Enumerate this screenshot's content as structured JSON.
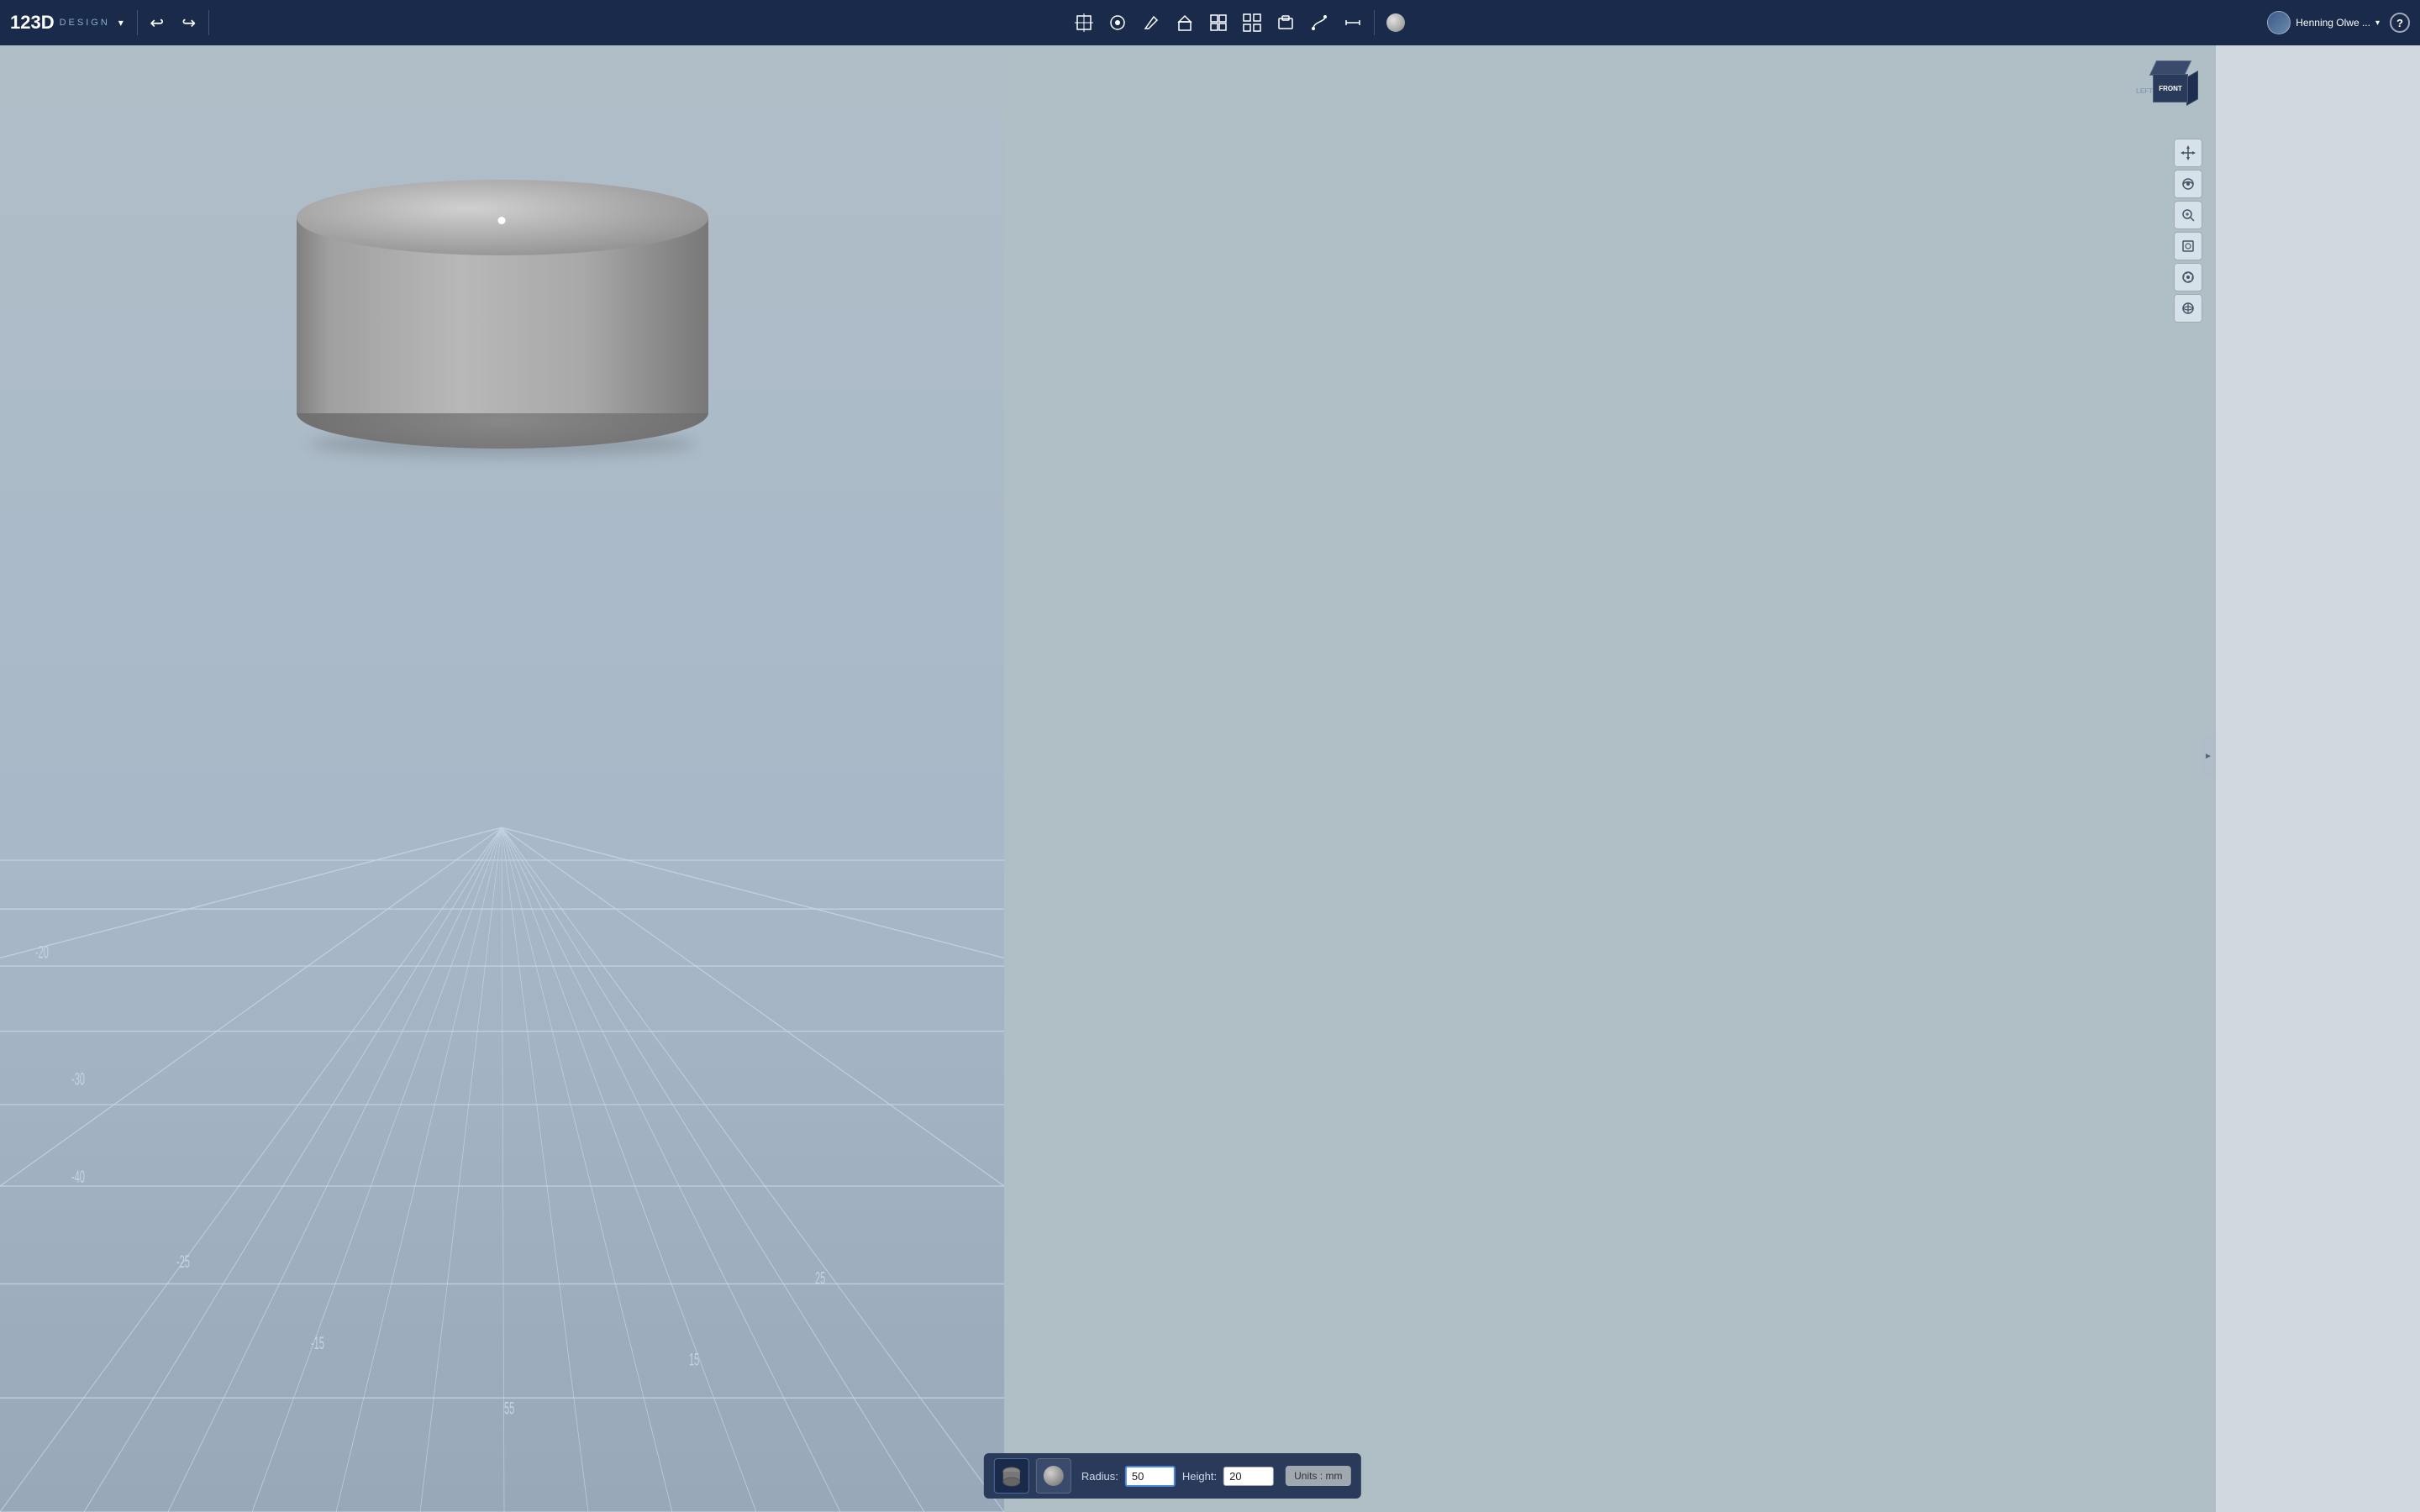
{
  "app": {
    "name": "123D",
    "design_label": "DESIGN",
    "dropdown_arrow": "▾"
  },
  "header": {
    "undo_label": "↩",
    "redo_label": "↪",
    "tools": [
      {
        "name": "transform",
        "icon": "⊞",
        "label": "Transform"
      },
      {
        "name": "primitives",
        "icon": "◉",
        "label": "Primitives"
      },
      {
        "name": "sketch",
        "icon": "✏",
        "label": "Sketch"
      },
      {
        "name": "construct",
        "icon": "🔨",
        "label": "Construct"
      },
      {
        "name": "modify",
        "icon": "⊡",
        "label": "Modify"
      },
      {
        "name": "pattern",
        "icon": "⊞",
        "label": "Pattern"
      },
      {
        "name": "group",
        "icon": "◧",
        "label": "Group"
      },
      {
        "name": "snap",
        "icon": "⌂",
        "label": "Snap"
      },
      {
        "name": "measure",
        "icon": "↔",
        "label": "Measure"
      }
    ],
    "material_ball": "⬤",
    "user_name": "Henning Olwe ...",
    "help": "?"
  },
  "cube_navigator": {
    "front_label": "FRONT",
    "left_label": "LEFT"
  },
  "view_controls": [
    {
      "icon": "✛",
      "name": "pan"
    },
    {
      "icon": "↻",
      "name": "orbit"
    },
    {
      "icon": "🔍",
      "name": "zoom"
    },
    {
      "icon": "⊡",
      "name": "fit"
    },
    {
      "icon": "◎",
      "name": "perspective"
    },
    {
      "icon": "👁",
      "name": "view-menu"
    }
  ],
  "viewport": {
    "grid_color": "#c0ccd8",
    "bg_color": "#aab8c8"
  },
  "bottom_toolbar": {
    "cylinder_icon": "⬛",
    "sphere_icon": "⬤",
    "radius_label": "Radius:",
    "radius_value": "50",
    "height_label": "Height:",
    "height_value": "20",
    "units_label": "Units : mm"
  }
}
